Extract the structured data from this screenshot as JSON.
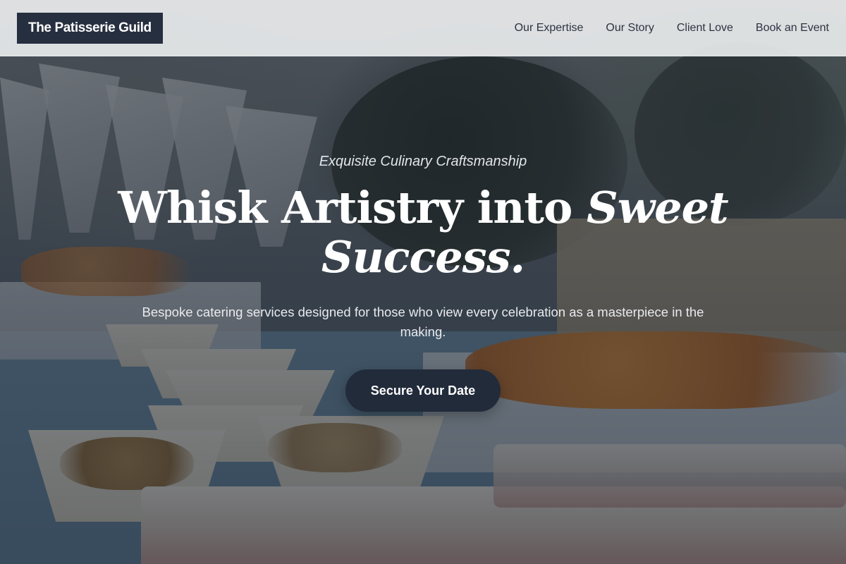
{
  "header": {
    "logo_text": "The Patisserie Guild",
    "nav": [
      {
        "label": "Our Expertise"
      },
      {
        "label": "Our Story"
      },
      {
        "label": "Client Love"
      },
      {
        "label": "Book an Event"
      }
    ]
  },
  "hero": {
    "kicker": "Exquisite Culinary Craftsmanship",
    "headline_plain": "Whisk Artistry into ",
    "headline_accent": "Sweet Success.",
    "subtext": "Bespoke catering services designed for those who view every celebration as a masterpiece in the making.",
    "cta_label": "Secure Your Date"
  },
  "colors": {
    "header_bg": "#e9ebed",
    "logo_bg": "#262f3f",
    "nav_text": "#2c3442",
    "cta_bg": "#222b3a",
    "hero_text": "#ffffff"
  }
}
